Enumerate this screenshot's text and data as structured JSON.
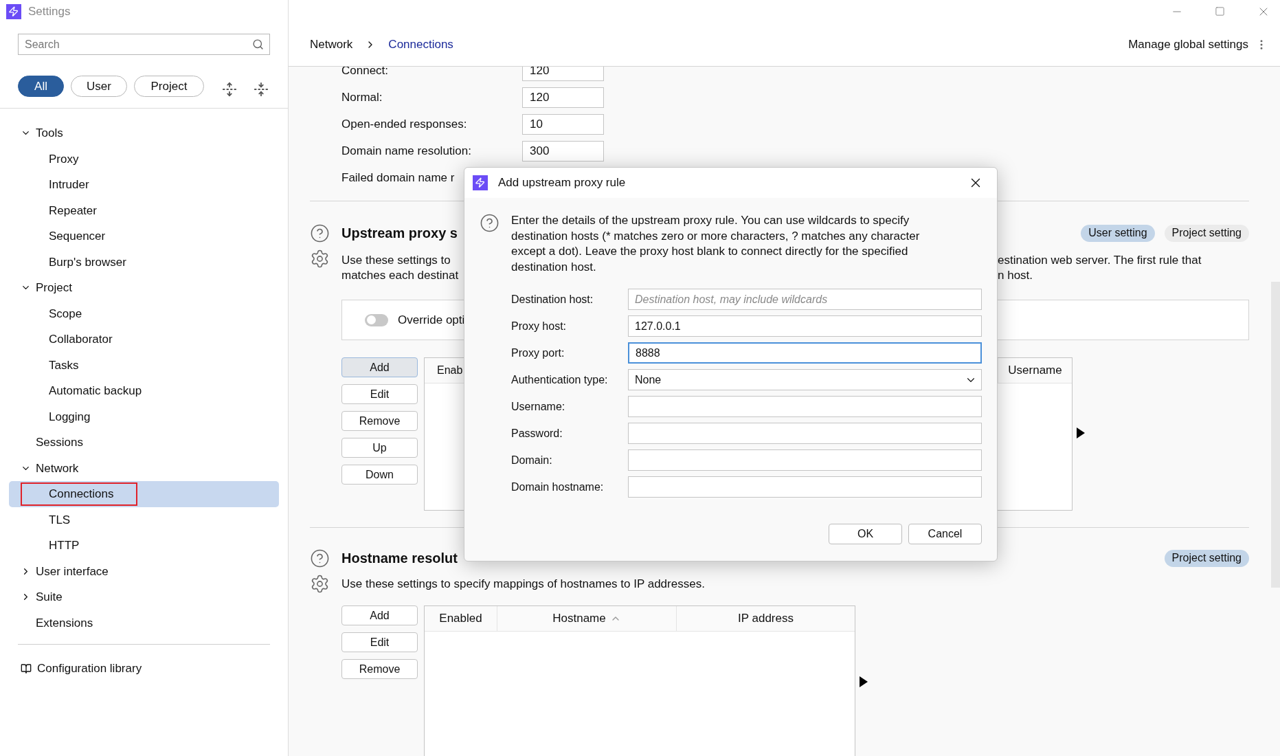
{
  "window": {
    "title": "Settings"
  },
  "sidebar": {
    "search": {
      "placeholder": "Search"
    },
    "filters": [
      {
        "label": "All",
        "selected": true
      },
      {
        "label": "User",
        "selected": false
      },
      {
        "label": "Project",
        "selected": false
      }
    ],
    "tree": [
      {
        "label": "Tools",
        "expanded": true,
        "selected": false,
        "children": [
          {
            "label": "Proxy",
            "selected": false
          },
          {
            "label": "Intruder",
            "selected": false
          },
          {
            "label": "Repeater",
            "selected": false
          },
          {
            "label": "Sequencer",
            "selected": false
          },
          {
            "label": "Burp's browser",
            "selected": false
          }
        ]
      },
      {
        "label": "Project",
        "expanded": true,
        "selected": false,
        "children": [
          {
            "label": "Scope",
            "selected": false
          },
          {
            "label": "Collaborator",
            "selected": false
          },
          {
            "label": "Tasks",
            "selected": false
          },
          {
            "label": "Automatic backup",
            "selected": false
          },
          {
            "label": "Logging",
            "selected": false
          }
        ]
      },
      {
        "label": "Sessions",
        "selected": false
      },
      {
        "label": "Network",
        "expanded": true,
        "selected": false,
        "children": [
          {
            "label": "Connections",
            "selected": true
          },
          {
            "label": "TLS",
            "selected": false
          },
          {
            "label": "HTTP",
            "selected": false
          }
        ]
      },
      {
        "label": "User interface",
        "expanded": false,
        "selected": false
      },
      {
        "label": "Suite",
        "expanded": false,
        "selected": false
      },
      {
        "label": "Extensions",
        "selected": false
      }
    ],
    "footer_link": "Configuration library"
  },
  "header": {
    "breadcrumb": [
      "Network",
      "Connections"
    ],
    "action": "Manage global settings"
  },
  "timeouts": [
    {
      "label": "Connect:",
      "value": "120"
    },
    {
      "label": "Normal:",
      "value": "120"
    },
    {
      "label": "Open-ended responses:",
      "value": "10"
    },
    {
      "label": "Domain name resolution:",
      "value": "300"
    },
    {
      "label": "Failed domain name r"
    }
  ],
  "upstream_proxy": {
    "title": "Upstream proxy s",
    "badges": [
      {
        "label": "User setting",
        "selected": true
      },
      {
        "label": "Project setting",
        "selected": false
      }
    ],
    "description_left": [
      "Use these settings to",
      "matches each destinat"
    ],
    "description_right": [
      "estination web server. The first rule that",
      "n host."
    ],
    "override": {
      "label": "Override opti",
      "on": false
    },
    "buttons": [
      {
        "label": "Add",
        "focused": true
      },
      {
        "label": "Edit",
        "focused": false
      },
      {
        "label": "Remove",
        "focused": false
      },
      {
        "label": "Up",
        "focused": false
      },
      {
        "label": "Down",
        "focused": false
      }
    ],
    "table": {
      "columns": [
        "Enab",
        "Username"
      ]
    }
  },
  "hostname_resolution": {
    "title": "Hostname resolut",
    "badges": [
      {
        "label": "Project setting",
        "selected": true
      }
    ],
    "description": "Use these settings to specify mappings of hostnames to IP addresses.",
    "buttons": [
      {
        "label": "Add",
        "focused": false
      },
      {
        "label": "Edit",
        "focused": false
      },
      {
        "label": "Remove",
        "focused": false
      }
    ],
    "table": {
      "columns": [
        {
          "label": "Enabled",
          "sorted": false
        },
        {
          "label": "Hostname",
          "sorted": true
        },
        {
          "label": "IP address",
          "sorted": false
        }
      ]
    }
  },
  "dialog": {
    "title": "Add upstream proxy rule",
    "intro": "Enter the details of the upstream proxy rule. You can use wildcards to specify destination hosts (* matches zero or more characters, ? matches any character except a dot). Leave the proxy host blank to connect directly for the specified destination host.",
    "fields": [
      {
        "label": "Destination host:",
        "kind": "text",
        "placeholder": "Destination host, may include wildcards",
        "focused": false
      },
      {
        "label": "Proxy host:",
        "kind": "text",
        "value": "127.0.0.1",
        "focused": false
      },
      {
        "label": "Proxy port:",
        "kind": "text",
        "value": "8888",
        "focused": true
      },
      {
        "label": "Authentication type:",
        "kind": "select",
        "value": "None",
        "focused": false
      },
      {
        "label": "Username:",
        "kind": "text",
        "focused": false
      },
      {
        "label": "Password:",
        "kind": "text",
        "focused": false
      },
      {
        "label": "Domain:",
        "kind": "text",
        "focused": false
      },
      {
        "label": "Domain hostname:",
        "kind": "text",
        "focused": false
      }
    ],
    "buttons": [
      "OK",
      "Cancel"
    ]
  }
}
